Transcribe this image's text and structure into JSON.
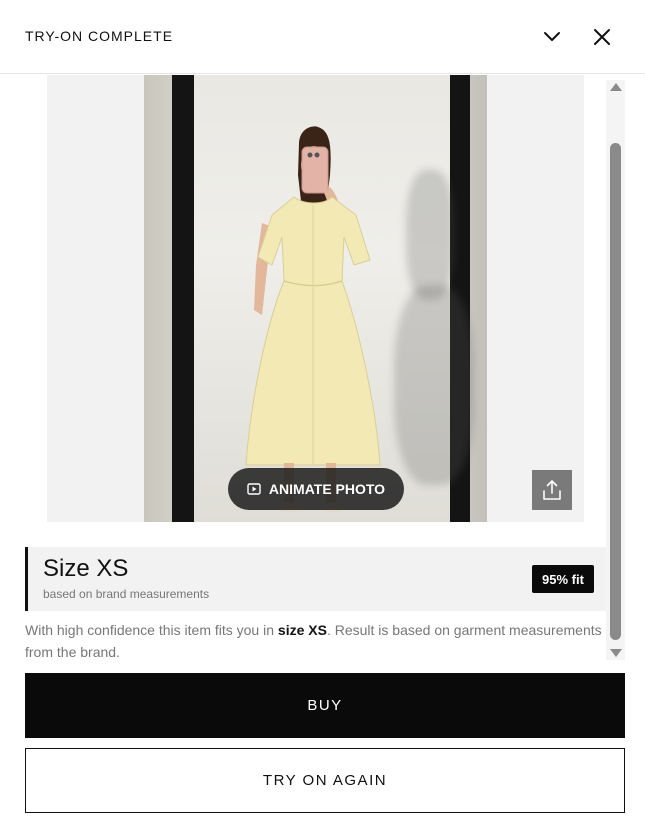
{
  "header": {
    "title": "TRY-ON COMPLETE",
    "collapse_icon": "chevron-down-icon",
    "close_icon": "close-icon"
  },
  "photo": {
    "animate_label": "ANIMATE PHOTO",
    "animate_icon": "play-icon",
    "share_icon": "share-icon"
  },
  "size_card": {
    "title": "Size XS",
    "subtitle": "based on brand measurements",
    "fit_badge": "95% fit"
  },
  "description": {
    "before": "With high confidence this item fits you in ",
    "highlight": "size XS",
    "after": ". Result is based on garment measurements from the brand."
  },
  "actions": {
    "buy_label": "BUY",
    "try_again_label": "TRY ON AGAIN"
  },
  "colors": {
    "primary": "#0a0a0a",
    "panel": "#f2f2f2",
    "muted_text": "#777777",
    "dress": "#f2e9b4"
  }
}
